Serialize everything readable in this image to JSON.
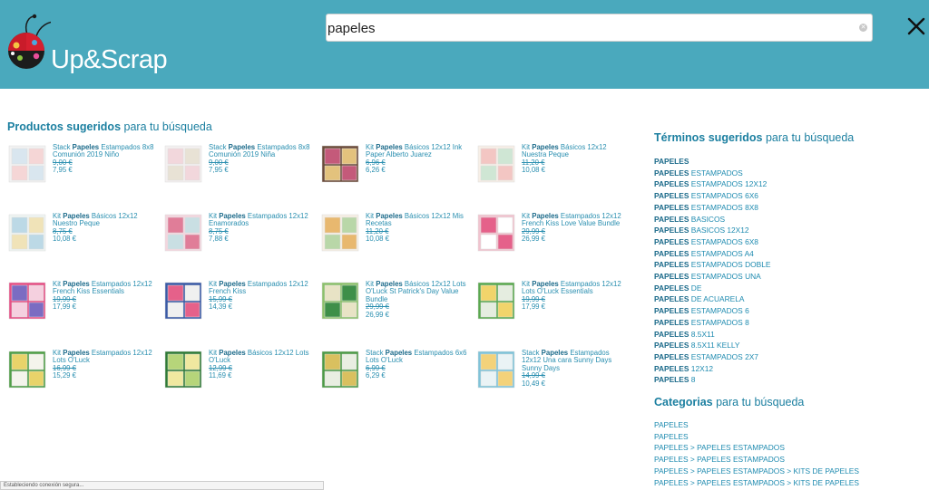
{
  "header": {
    "logo_text": "Up&Scrap",
    "search_value": "papeles"
  },
  "products_section": {
    "title_bold": "Productos sugeridos",
    "title_rest": " para tu búsqueda"
  },
  "terms_section": {
    "title_bold": "Términos sugeridos",
    "title_rest": " para tu búsqueda",
    "items": [
      {
        "bold": "PAPELES",
        "rest": ""
      },
      {
        "bold": "PAPELES",
        "rest": " ESTAMPADOS"
      },
      {
        "bold": "PAPELES",
        "rest": " ESTAMPADOS 12X12"
      },
      {
        "bold": "PAPELES",
        "rest": " ESTAMPADOS 6X6"
      },
      {
        "bold": "PAPELES",
        "rest": " ESTAMPADOS 8X8"
      },
      {
        "bold": "PAPELES",
        "rest": " BASICOS"
      },
      {
        "bold": "PAPELES",
        "rest": " BASICOS 12X12"
      },
      {
        "bold": "PAPELES",
        "rest": " ESTAMPADOS 6X8"
      },
      {
        "bold": "PAPELES",
        "rest": " ESTAMPADOS A4"
      },
      {
        "bold": "PAPELES",
        "rest": " ESTAMPADOS DOBLE"
      },
      {
        "bold": "PAPELES",
        "rest": " ESTAMPADOS UNA"
      },
      {
        "bold": "PAPELES",
        "rest": " DE"
      },
      {
        "bold": "PAPELES",
        "rest": " DE ACUARELA"
      },
      {
        "bold": "PAPELES",
        "rest": " ESTAMPADOS 6"
      },
      {
        "bold": "PAPELES",
        "rest": " ESTAMPADOS 8"
      },
      {
        "bold": "PAPELES",
        "rest": " 8.5X11"
      },
      {
        "bold": "PAPELES",
        "rest": " 8.5X11 KELLY"
      },
      {
        "bold": "PAPELES",
        "rest": " ESTAMPADOS 2X7"
      },
      {
        "bold": "PAPELES",
        "rest": " 12X12"
      },
      {
        "bold": "PAPELES",
        "rest": " 8"
      }
    ]
  },
  "categories_section": {
    "title_bold": "Categorias",
    "title_rest": " para tu búsqueda",
    "items": [
      "PAPELES",
      "PAPELES",
      "PAPELES > PAPELES ESTAMPADOS",
      "PAPELES > PAPELES ESTAMPADOS",
      "PAPELES > PAPELES ESTAMPADOS > KITS DE PAPELES",
      "PAPELES > PAPELES ESTAMPADOS > KITS DE PAPELES"
    ]
  },
  "products": [
    {
      "pre": "Stack ",
      "bold": "Papeles",
      "post": " Estampados 8x8 Comunión 2019 Niño",
      "old": "9,00 €",
      "new": "7,95 €",
      "colors": [
        "#f2f2f2",
        "#d9e6ef",
        "#f5d6d6"
      ]
    },
    {
      "pre": "Stack ",
      "bold": "Papeles",
      "post": " Estampados 8x8 Comunión 2019 Niña",
      "old": "9,00 €",
      "new": "7,95 €",
      "colors": [
        "#f4f0f0",
        "#f2d7dc",
        "#e8e2d5"
      ]
    },
    {
      "pre": "Kit ",
      "bold": "Papeles",
      "post": " Básicos 12x12 Ink Paper Alberto Juarez",
      "old": "6,96 €",
      "new": "6,26 €",
      "colors": [
        "#6b4b3a",
        "#c45a7a",
        "#e3c27d"
      ]
    },
    {
      "pre": "Kit ",
      "bold": "Papeles",
      "post": " Básicos 12x12 Nuestra Peque",
      "old": "11,20 €",
      "new": "10,08 €",
      "colors": [
        "#f7efe7",
        "#f3c6c3",
        "#cfe6d4"
      ]
    },
    {
      "pre": "Kit ",
      "bold": "Papeles",
      "post": " Básicos 12x12 Nuestro Peque",
      "old": "8,75 €",
      "new": "10,08 €",
      "colors": [
        "#eef4f2",
        "#bcd9e6",
        "#f0e3b8"
      ]
    },
    {
      "pre": "Kit ",
      "bold": "Papeles",
      "post": " Estampados 12x12 Enamorados",
      "old": "8,75 €",
      "new": "7,88 €",
      "colors": [
        "#f3d6de",
        "#e07d98",
        "#c9dfe3"
      ]
    },
    {
      "pre": "Kit ",
      "bold": "Papeles",
      "post": " Básicos 12x12 Mis Recetas",
      "old": "11,20 €",
      "new": "10,08 €",
      "colors": [
        "#f6efe4",
        "#e8b86f",
        "#b9d7a8"
      ]
    },
    {
      "pre": "Kit ",
      "bold": "Papeles",
      "post": " Estampados 12x12 French Kiss Love Value Bundle",
      "old": "29,99 €",
      "new": "26,99 €",
      "colors": [
        "#f1c3cf",
        "#e5618a",
        "#ffffff"
      ]
    },
    {
      "pre": "Kit ",
      "bold": "Papeles",
      "post": " Estampados 12x12 French Kiss Essentials",
      "old": "19,99 €",
      "new": "17,99 €",
      "colors": [
        "#e64f85",
        "#7b6cc2",
        "#f5d0df"
      ]
    },
    {
      "pre": "Kit ",
      "bold": "Papeles",
      "post": " Estampados 12x12 French Kiss",
      "old": "15,99 €",
      "new": "14,39 €",
      "colors": [
        "#3a5aa6",
        "#e5618a",
        "#f0f0f0"
      ]
    },
    {
      "pre": "Kit ",
      "bold": "Papeles",
      "post": " Básicos 12x12 Lots O'Luck St Patrick's Day Value Bundle",
      "old": "29,99 €",
      "new": "26,99 €",
      "colors": [
        "#8cc06b",
        "#e8e3c5",
        "#3e8f49"
      ]
    },
    {
      "pre": "Kit ",
      "bold": "Papeles",
      "post": " Estampados 12x12 Lots O'Luck Essentials",
      "old": "19,99 €",
      "new": "17,99 €",
      "colors": [
        "#5aa84f",
        "#f1d46b",
        "#e5ede0"
      ]
    },
    {
      "pre": "Kit ",
      "bold": "Papeles",
      "post": " Estampados 12x12 Lots O'Luck",
      "old": "16,99 €",
      "new": "15,29 €",
      "colors": [
        "#4f9e46",
        "#e8d36a",
        "#f4f4ec"
      ]
    },
    {
      "pre": "Kit ",
      "bold": "Papeles",
      "post": " Básicos 12x12 Lots O'Luck",
      "old": "12,99 €",
      "new": "11,69 €",
      "colors": [
        "#2f7a35",
        "#b6d57a",
        "#f0e8a0"
      ]
    },
    {
      "pre": "Stack ",
      "bold": "Papeles",
      "post": " Estampados 6x6 Lots O'Luck",
      "old": "6,99 €",
      "new": "6,29 €",
      "colors": [
        "#4b9a45",
        "#d9c05f",
        "#e9eee2"
      ]
    },
    {
      "pre": "Stack ",
      "bold": "Papeles",
      "post": " Estampados 12x12 Una cara Sunny Days Sunny Days",
      "old": "14,99 €",
      "new": "10,49 €",
      "colors": [
        "#7fc3d9",
        "#f3d27a",
        "#eaf3f5"
      ]
    }
  ],
  "status_bar_text": "Estableciendo conexión segura..."
}
